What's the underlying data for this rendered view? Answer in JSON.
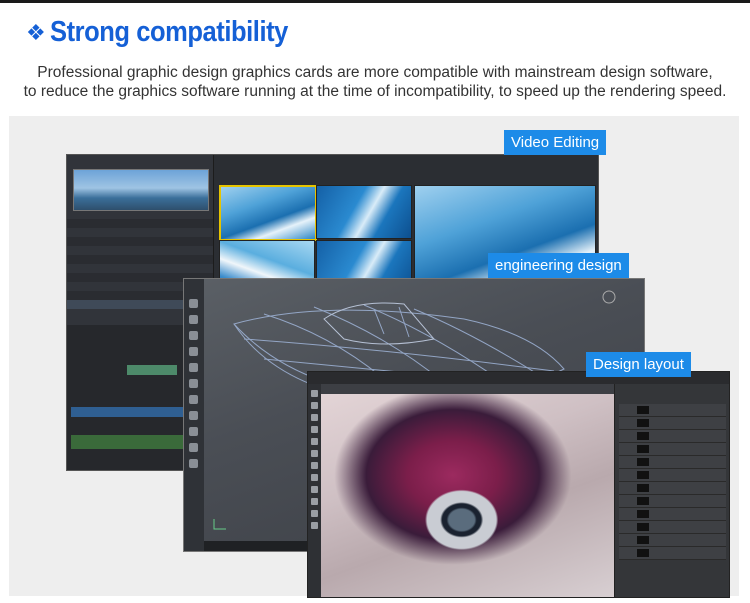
{
  "header": {
    "icon": "diamond-icon",
    "title": "Strong compatibility"
  },
  "description": {
    "line1": "Professional graphic design graphics cards are more compatible with mainstream design software,",
    "line2": "to reduce the graphics software running at the time of incompatibility, to speed up the rendering speed."
  },
  "labels": {
    "video": "Video Editing",
    "engineering": "engineering design",
    "layout": "Design layout"
  },
  "colors": {
    "accent": "#1560d6",
    "label_bg": "#1d8be8",
    "stage_bg": "#eeeeee"
  }
}
